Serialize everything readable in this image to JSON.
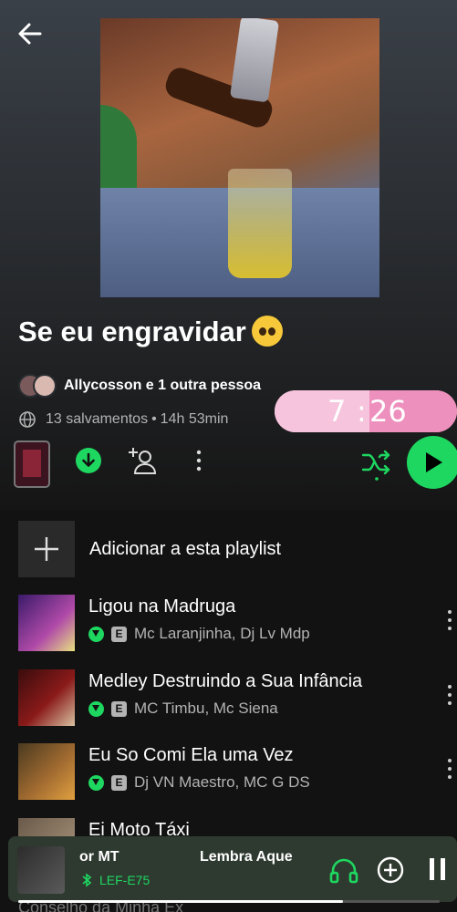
{
  "playlist": {
    "title": "Se eu engravidar",
    "owners": "Allycosson e 1 outra pessoa",
    "saves": "13 salvamentos",
    "separator": "•",
    "duration": "14h 53min"
  },
  "overlay_clock": {
    "hours": "7",
    "colon": ":",
    "minutes": "26"
  },
  "actions": {
    "add_to_playlist": "Adicionar a esta playlist"
  },
  "tracks": [
    {
      "title": "Ligou na Madruga",
      "artists": "Mc Laranjinha, Dj Lv Mdp",
      "explicit": "E",
      "downloaded": true
    },
    {
      "title": "Medley Destruindo a Sua Infância",
      "artists": "MC Timbu, Mc Siena",
      "explicit": "E",
      "downloaded": true
    },
    {
      "title": "Eu So Comi Ela uma Vez",
      "artists": "Dj VN Maestro, MC G DS",
      "explicit": "E",
      "downloaded": true
    },
    {
      "title": "Ei Moto Táxi",
      "artists": ""
    }
  ],
  "now_playing": {
    "title_left": "or MT",
    "title_right": "Lembra Aque",
    "device": "LEF-E75",
    "progress": 0.77
  },
  "next_hidden_track": "Conselho da Minha Ex",
  "colors": {
    "accent": "#1ed760",
    "bg": "#121212",
    "clock_pink": "#f4b8d4"
  }
}
